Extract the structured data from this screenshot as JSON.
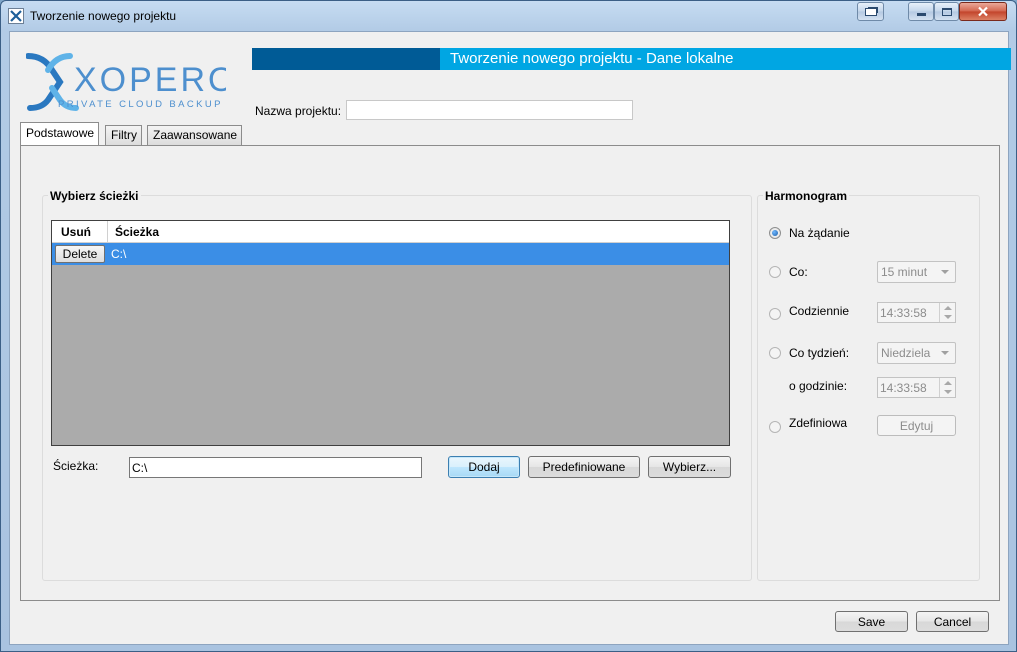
{
  "window": {
    "title": "Tworzenie nowego projektu"
  },
  "header": {
    "title": "Tworzenie nowego projektu - Dane lokalne"
  },
  "logo": {
    "brand": "XOPERO",
    "tagline": "PRIVATE CLOUD BACKUP"
  },
  "project": {
    "name_label": "Nazwa projektu:",
    "name_value": ""
  },
  "tabs": [
    {
      "label": "Podstawowe",
      "active": true
    },
    {
      "label": "Filtry",
      "active": false
    },
    {
      "label": "Zaawansowane",
      "active": false
    }
  ],
  "paths": {
    "group_title": "Wybierz ścieżki",
    "columns": [
      "Usuń",
      "Ścieżka"
    ],
    "rows": [
      {
        "delete_label": "Delete",
        "path": "C:\\"
      }
    ],
    "path_label": "Ścieżka:",
    "path_value": "C:\\",
    "buttons": {
      "add": "Dodaj",
      "predefined": "Predefiniowane",
      "choose": "Wybierz..."
    }
  },
  "schedule": {
    "group_title": "Harmonogram",
    "on_demand": "Na żądanie",
    "every": "Co:",
    "every_value": "15 minut",
    "daily": "Codziennie",
    "daily_time": "14:33:58",
    "weekly": "Co tydzień:",
    "weekly_day": "Niedziela",
    "at_hour": "o godzinie:",
    "weekly_time": "14:33:58",
    "custom": "Zdefiniowa",
    "edit": "Edytuj"
  },
  "footer": {
    "save": "Save",
    "cancel": "Cancel"
  },
  "colors": {
    "accent_light": "#00a6e3",
    "accent_dark": "#005b96",
    "selection": "#3b8ee6"
  }
}
